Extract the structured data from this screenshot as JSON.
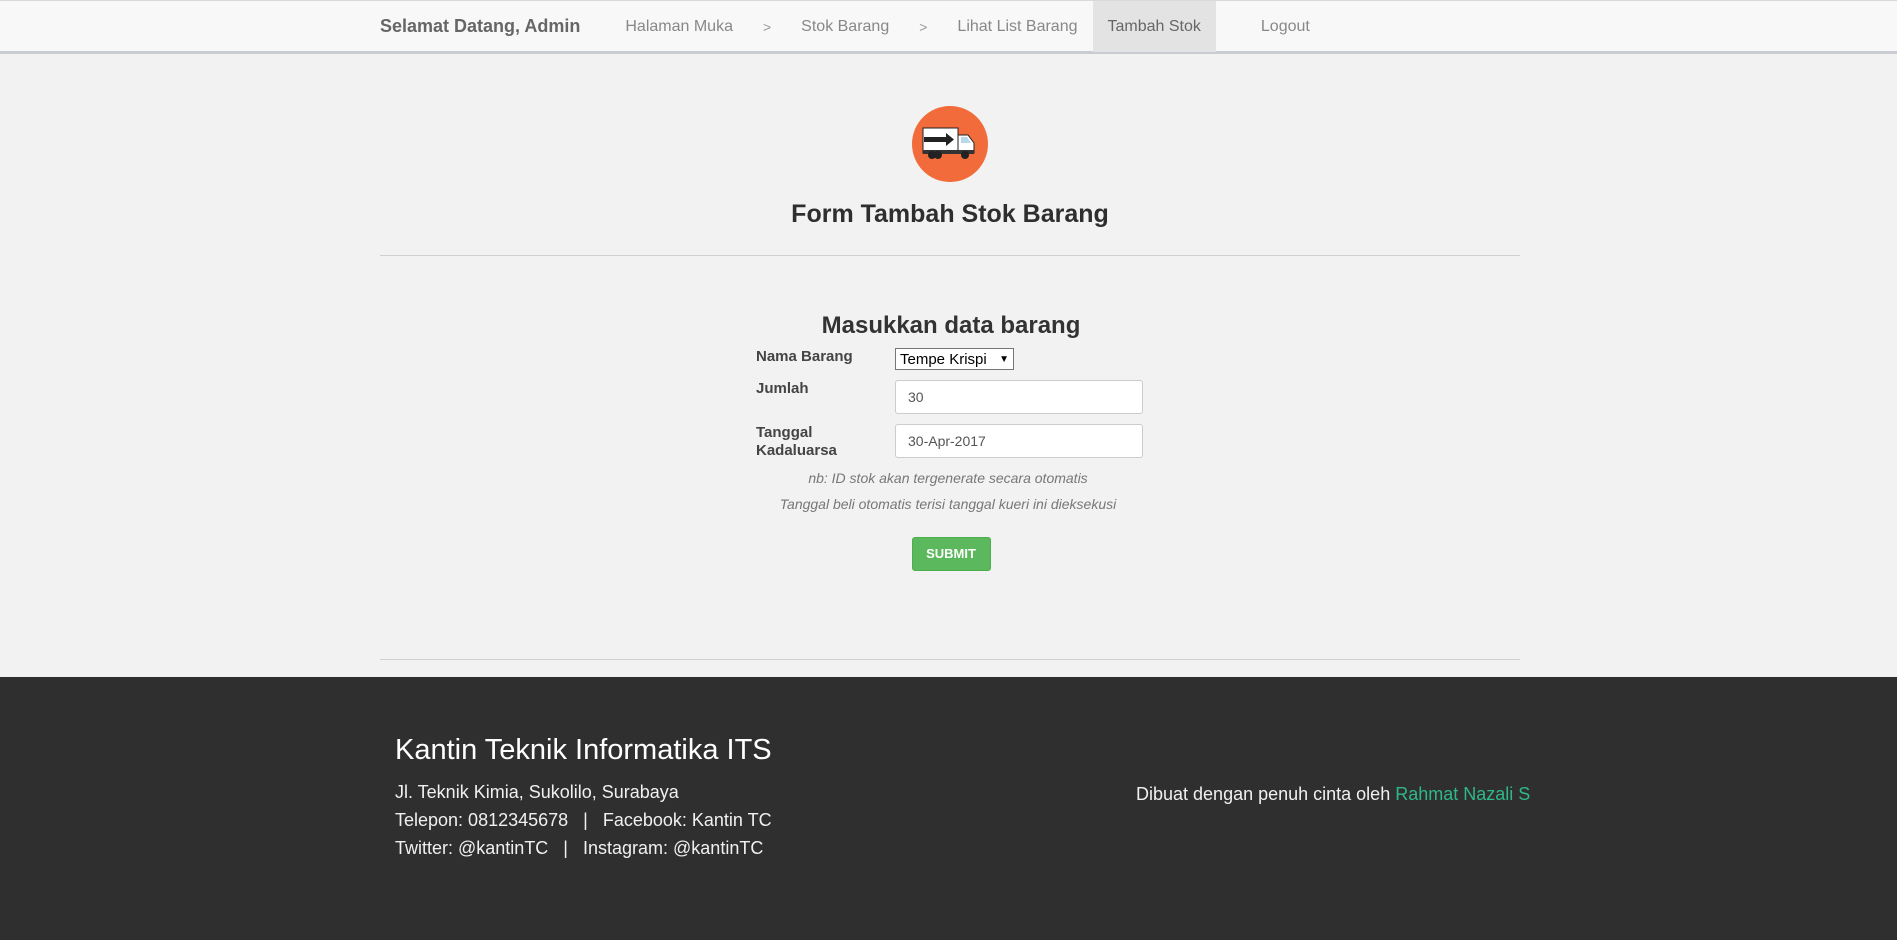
{
  "nav": {
    "brand": "Selamat Datang, Admin",
    "items": [
      {
        "label": "Halaman Muka"
      },
      {
        "label": "Stok Barang"
      },
      {
        "label": "Lihat List Barang"
      },
      {
        "label": "Tambah Stok"
      }
    ],
    "separator": ">",
    "logout": "Logout",
    "active": "Tambah Stok"
  },
  "page": {
    "icon": "delivery-truck-icon",
    "title": "Form Tambah Stok Barang"
  },
  "form": {
    "heading": "Masukkan data barang",
    "fields": {
      "nama_label": "Nama Barang",
      "nama_value": "Tempe Krispi",
      "jumlah_label": "Jumlah",
      "jumlah_value": "30",
      "tanggal_label_line1": "Tanggal",
      "tanggal_label_line2": "Kadaluarsa",
      "tanggal_value": "30-Apr-2017"
    },
    "note1": "nb: ID stok akan tergenerate secara otomatis",
    "note2": "Tanggal beli otomatis terisi tanggal kueri ini dieksekusi",
    "submit_label": "SUBMIT"
  },
  "footer": {
    "title": "Kantin Teknik Informatika ITS",
    "address": "Jl. Teknik Kimia, Sukolilo, Surabaya",
    "line2": "Telepon: 0812345678   |   Facebook: Kantin TC",
    "line3": "Twitter: @kantinTC   |   Instagram: @kantinTC",
    "credit_prefix": "Dibuat dengan penuh cinta oleh ",
    "credit_name": "Rahmat Nazali S"
  },
  "colors": {
    "accent_orange": "#f26b3a",
    "submit_green": "#5cb85c",
    "footer_bg": "#2f2f2f",
    "link_green": "#2eb88a"
  }
}
